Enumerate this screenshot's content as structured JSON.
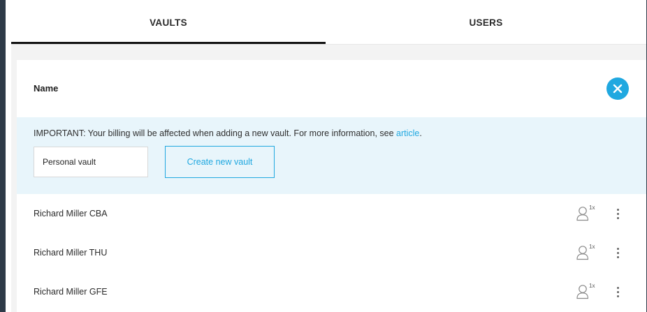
{
  "tabs": [
    {
      "label": "VAULTS",
      "active": true
    },
    {
      "label": "USERS",
      "active": false
    }
  ],
  "header": {
    "name_label": "Name"
  },
  "notice": {
    "text": "IMPORTANT: Your billing will be affected when adding a new vault. For more information, see ",
    "link": "article",
    "suffix": "."
  },
  "form": {
    "input_value": "Personal vault",
    "create_label": "Create new vault"
  },
  "vaults": [
    {
      "name": "Richard Miller CBA",
      "user_count": "1x"
    },
    {
      "name": "Richard Miller THU",
      "user_count": "1x"
    },
    {
      "name": "Richard Miller GFE",
      "user_count": "1x"
    }
  ],
  "colors": {
    "accent": "#20a8e0",
    "notice_bg": "#e8f5fb",
    "frame": "#2e3a48"
  }
}
